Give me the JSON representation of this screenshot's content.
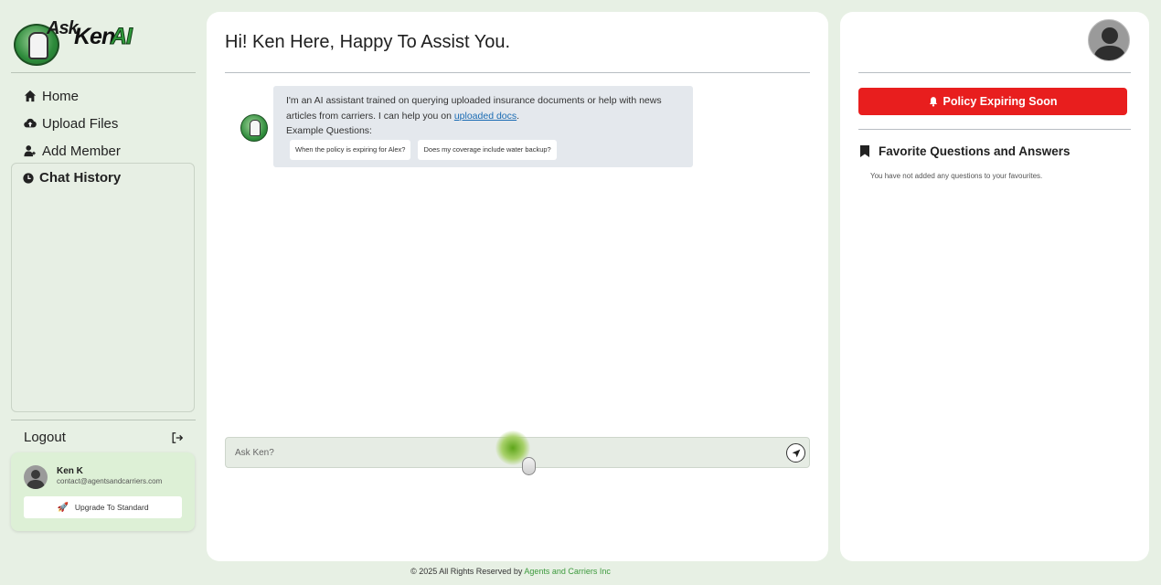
{
  "brand": {
    "logo_ask": "Ask",
    "logo_ken": "Ken",
    "logo_ai": "AI",
    "accent_green": "#2f9a3b"
  },
  "sidebar": {
    "nav": [
      {
        "label": "Home",
        "icon": "home-icon"
      },
      {
        "label": "Upload Files",
        "icon": "cloud-upload-icon"
      },
      {
        "label": "Add Member",
        "icon": "user-plus-icon"
      }
    ],
    "chat_history_label": "Chat History",
    "logout_label": "Logout",
    "user": {
      "name": "Ken K",
      "email": "contact@agentsandcarriers.com"
    },
    "upgrade_label": "Upgrade To Standard"
  },
  "chat": {
    "title": "Hi! Ken Here, Happy To Assist You.",
    "intro_text": "I'm an AI assistant trained on querying uploaded insurance documents or help with news articles from carriers. I can help you on ",
    "intro_link": "uploaded docs",
    "intro_end": ".",
    "examples_label": "Example Questions:",
    "examples": [
      "When the policy is expiring for Alex?",
      "Does my coverage include water backup?"
    ],
    "input_placeholder": "Ask Ken?"
  },
  "right_panel": {
    "alert_label": "Policy Expiring Soon",
    "alert_color": "#e81e1e",
    "favorites_title": "Favorite Questions and Answers",
    "favorites_empty": "You have not added any questions to your favourites."
  },
  "footer": {
    "copyright": "© 2025 All Rights Reserved by ",
    "company": "Agents and Carriers Inc"
  }
}
